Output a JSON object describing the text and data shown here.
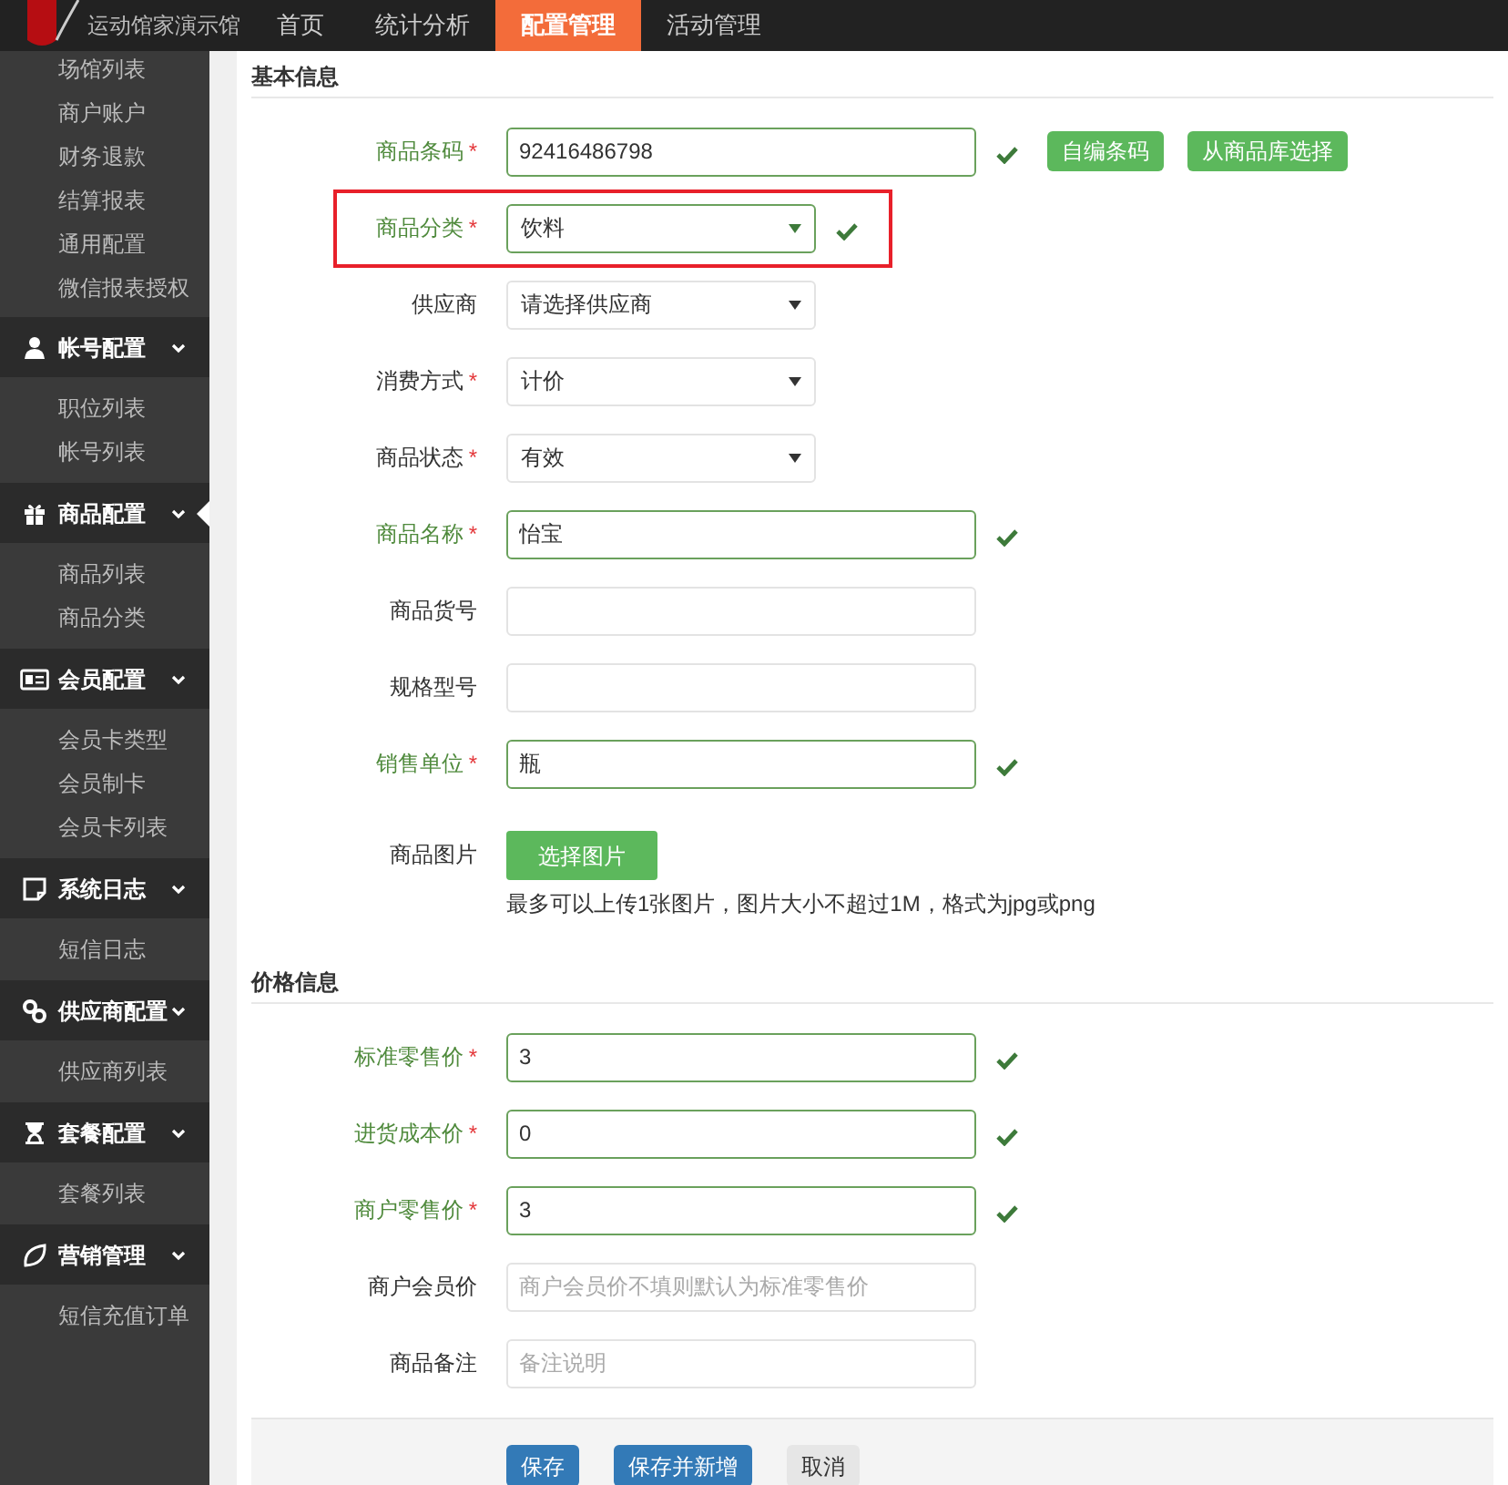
{
  "header": {
    "logo_text": "运动馆家演示馆",
    "nav": [
      {
        "label": "首页",
        "selected": false
      },
      {
        "label": "统计分析",
        "selected": false
      },
      {
        "label": "配置管理",
        "selected": true
      },
      {
        "label": "活动管理",
        "selected": false
      }
    ]
  },
  "sidebar": {
    "top_items": [
      {
        "label": "场馆列表"
      },
      {
        "label": "商户账户"
      },
      {
        "label": "财务退款"
      },
      {
        "label": "结算报表"
      },
      {
        "label": "通用配置"
      },
      {
        "label": "微信报表授权"
      }
    ],
    "groups": [
      {
        "label": "帐号配置",
        "expanded": true,
        "selected": false,
        "children": [
          {
            "label": "职位列表"
          },
          {
            "label": "帐号列表"
          }
        ]
      },
      {
        "label": "商品配置",
        "expanded": true,
        "selected": true,
        "children": [
          {
            "label": "商品列表"
          },
          {
            "label": "商品分类"
          }
        ]
      },
      {
        "label": "会员配置",
        "expanded": true,
        "selected": false,
        "children": [
          {
            "label": "会员卡类型"
          },
          {
            "label": "会员制卡"
          },
          {
            "label": "会员卡列表"
          }
        ]
      },
      {
        "label": "系统日志",
        "expanded": true,
        "selected": false,
        "children": [
          {
            "label": "短信日志"
          }
        ]
      },
      {
        "label": "供应商配置",
        "expanded": true,
        "selected": false,
        "children": [
          {
            "label": "供应商列表"
          }
        ]
      },
      {
        "label": "套餐配置",
        "expanded": true,
        "selected": false,
        "children": [
          {
            "label": "套餐列表"
          }
        ]
      },
      {
        "label": "营销管理",
        "expanded": true,
        "selected": false,
        "children": [
          {
            "label": "短信充值订单"
          }
        ]
      }
    ]
  },
  "sections": [
    {
      "title": "基本信息",
      "fields": [
        {
          "kind": "input",
          "label": "商品条码",
          "required_mark": "*",
          "valid": true,
          "value": "92416486798",
          "buttons": [
            "自编条码",
            "从商品库选择"
          ]
        },
        {
          "kind": "select",
          "label": "商品分类",
          "required_mark": "*",
          "valid": true,
          "value": "饮料",
          "highlighted": true
        },
        {
          "kind": "select",
          "label": "供应商",
          "valid": false,
          "value": "请选择供应商"
        },
        {
          "kind": "select",
          "label": "消费方式",
          "required_mark": "*",
          "valid": false,
          "value": "计价"
        },
        {
          "kind": "select",
          "label": "商品状态",
          "required_mark": "*",
          "valid": false,
          "value": "有效"
        },
        {
          "kind": "input",
          "label": "商品名称",
          "required_mark": "*",
          "valid": true,
          "value": "怡宝"
        },
        {
          "kind": "input",
          "label": "商品货号",
          "valid": false
        },
        {
          "kind": "input",
          "label": "规格型号",
          "valid": false
        },
        {
          "kind": "input",
          "label": "销售单位",
          "required_mark": "*",
          "valid": true,
          "value": "瓶"
        },
        {
          "kind": "upload",
          "label": "商品图片",
          "valid": false,
          "button": "选择图片",
          "hint": "最多可以上传1张图片，图片大小不超过1M，格式为jpg或png"
        }
      ]
    },
    {
      "title": "价格信息",
      "fields": [
        {
          "kind": "input",
          "label": "标准零售价",
          "required_mark": "*",
          "valid": true,
          "value": "3"
        },
        {
          "kind": "input",
          "label": "进货成本价",
          "required_mark": "*",
          "valid": true,
          "value": "0"
        },
        {
          "kind": "input",
          "label": "商户零售价",
          "required_mark": "*",
          "valid": true,
          "value": "3"
        },
        {
          "kind": "input",
          "label": "商户会员价",
          "valid": false,
          "placeholder": "商户会员价不填则默认为标准零售价"
        },
        {
          "kind": "input",
          "label": "商品备注",
          "valid": false,
          "placeholder": "备注说明"
        }
      ]
    }
  ],
  "footer": {
    "buttons": [
      {
        "label": "保存",
        "kind": "primary"
      },
      {
        "label": "保存并新增",
        "kind": "primary"
      },
      {
        "label": "取消",
        "kind": "default"
      }
    ]
  }
}
